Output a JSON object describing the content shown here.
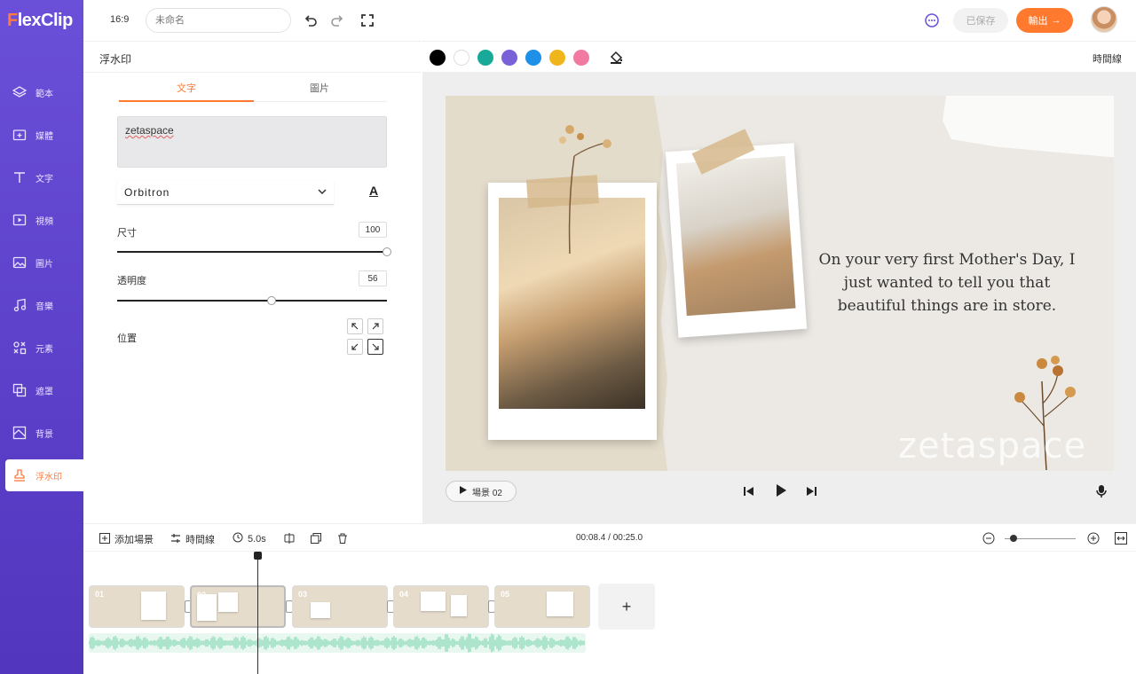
{
  "app": {
    "logo": "FlexClip",
    "logo_prefix": "F",
    "logo_rest": "lexClip"
  },
  "topbar": {
    "ratio": "16:9",
    "name_placeholder": "未命名",
    "saved_label": "已保存",
    "export_label": "輸出"
  },
  "sidebar": {
    "items": [
      {
        "label": "範本",
        "icon": "layers-icon"
      },
      {
        "label": "媒體",
        "icon": "folder-icon"
      },
      {
        "label": "文字",
        "icon": "text-icon"
      },
      {
        "label": "視頻",
        "icon": "video-icon"
      },
      {
        "label": "圖片",
        "icon": "image-icon"
      },
      {
        "label": "音樂",
        "icon": "music-icon"
      },
      {
        "label": "元素",
        "icon": "elements-icon"
      },
      {
        "label": "遮罩",
        "icon": "overlay-icon"
      },
      {
        "label": "背景",
        "icon": "background-icon"
      },
      {
        "label": "浮水印",
        "icon": "stamp-icon"
      }
    ]
  },
  "panel": {
    "title": "浮水印",
    "tabs": [
      {
        "label": "文字"
      },
      {
        "label": "圖片"
      }
    ],
    "text_value": "zetaspace",
    "font": "Orbitron",
    "size_label": "尺寸",
    "size_value": "100",
    "opacity_label": "透明度",
    "opacity_value": "56",
    "position_label": "位置"
  },
  "stagebar": {
    "colors": [
      "#000000",
      "#ffffff",
      "#18a999",
      "#7b61d8",
      "#1e90e8",
      "#f0b51b",
      "#f07aa0"
    ],
    "timeline_label": "時間線"
  },
  "canvas": {
    "quote": "On your very first Mother's Day, I just wanted to tell you that beautiful things are in store.",
    "watermark": "zetaspace"
  },
  "player": {
    "scene_label": "場景 02"
  },
  "timeline": {
    "add_scene": "添加場景",
    "timeline_label": "時間線",
    "duration": "5.0s",
    "time_readout": "00:08.4 / 00:25.0",
    "scenes": [
      "01",
      "02",
      "03",
      "04",
      "05"
    ],
    "add_button": "+"
  }
}
